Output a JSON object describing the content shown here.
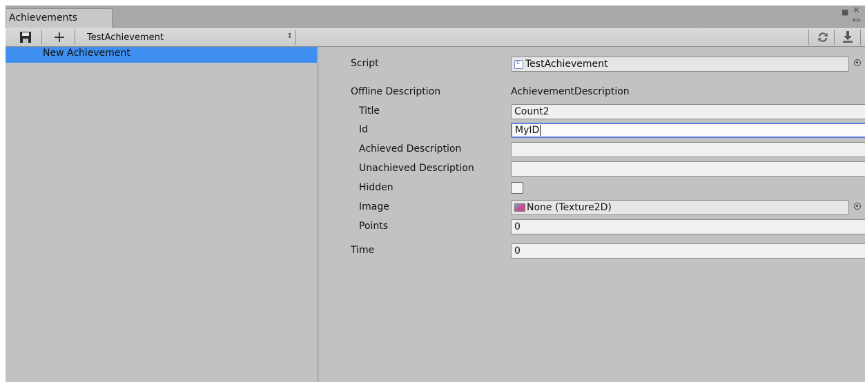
{
  "window": {
    "tab_title": "Achievements"
  },
  "toolbar": {
    "add_label": "+",
    "dropdown_value": "TestAchievement",
    "dropdown_arrow": "↕"
  },
  "list": {
    "items": [
      {
        "label": "New Achievement",
        "selected": true
      }
    ]
  },
  "inspector": {
    "script": {
      "label": "Script",
      "value": "TestAchievement"
    },
    "offline_description": {
      "label": "Offline Description",
      "value": "AchievementDescription"
    },
    "title": {
      "label": "Title",
      "value": "Count2"
    },
    "id": {
      "label": "Id",
      "value": "MyID"
    },
    "achieved_description": {
      "label": "Achieved Description",
      "value": ""
    },
    "unachieved_description": {
      "label": "Unachieved Description",
      "value": ""
    },
    "hidden": {
      "label": "Hidden",
      "checked": false
    },
    "image": {
      "label": "Image",
      "value": "None (Texture2D)"
    },
    "points": {
      "label": "Points",
      "value": "0"
    },
    "time": {
      "label": "Time",
      "value": "0"
    }
  },
  "colors": {
    "selection": "#3e8ff0",
    "panel": "#c2c2c2",
    "focus_border": "#5a7fd6"
  }
}
